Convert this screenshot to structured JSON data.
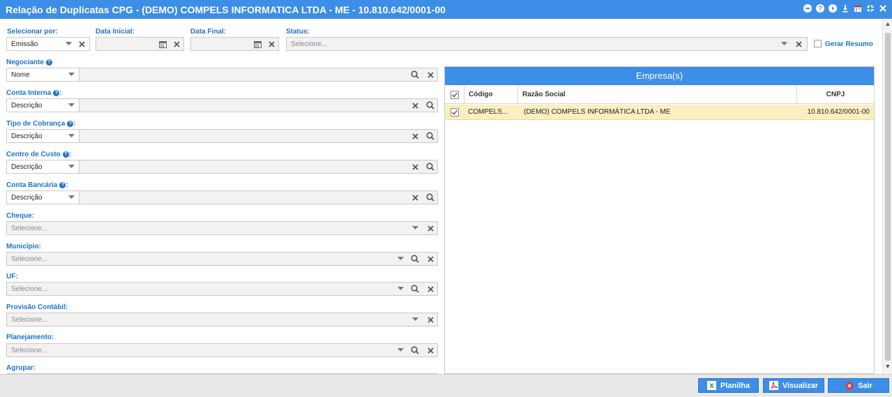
{
  "window": {
    "title": "Relação de Duplicatas CPG - (DEMO) COMPELS INFORMATICA LTDA - ME - 10.810.642/0001-00"
  },
  "filters": {
    "selecionar_por": {
      "label": "Selecionar por:",
      "value": "Emissão"
    },
    "data_inicial": {
      "label": "Data Inicial:",
      "value": ""
    },
    "data_final": {
      "label": "Data Final:",
      "value": ""
    },
    "status": {
      "label": "Status:",
      "placeholder": "Selecione..."
    },
    "gerar_resumo": {
      "label": "Gerar Resumo",
      "checked": false
    },
    "negociante": {
      "label": "Negociante",
      "select": "Nome"
    },
    "conta_interna": {
      "label": "Conta Interna",
      "select": "Descrição"
    },
    "tipo_cobranca": {
      "label": "Tipo de Cobrança",
      "select": "Descrição"
    },
    "centro_custo": {
      "label": "Centro de Custo",
      "select": "Descrição"
    },
    "conta_bancaria": {
      "label": "Conta Bancária",
      "select": "Descrição"
    },
    "cheque": {
      "label": "Cheque:",
      "placeholder": "Selecione..."
    },
    "municipio": {
      "label": "Município:",
      "placeholder": "Selecione..."
    },
    "uf": {
      "label": "UF:",
      "placeholder": "Selecione..."
    },
    "provisao": {
      "label": "Provisão Contábil:",
      "placeholder": "Selecione..."
    },
    "planejamento": {
      "label": "Planejamento:",
      "placeholder": "Selecione..."
    },
    "agrupar": {
      "label": "Agrupar:"
    }
  },
  "empresas": {
    "title": "Empresa(s)",
    "columns": [
      "Código",
      "Razão Social",
      "CNPJ"
    ],
    "rows": [
      {
        "codigo": "COMPELS...",
        "razao": "(DEMO) COMPELS INFORMÁTICA LTDA - ME",
        "cnpj": "10.810.642/0001-00",
        "checked": true
      }
    ]
  },
  "footer": {
    "planilha": "Planilha",
    "visualizar": "Visualizar",
    "sair": "Sair"
  },
  "colors": {
    "accent": "#3c8ee6",
    "label": "#1e73c8",
    "selected_row": "#fbefc1"
  }
}
